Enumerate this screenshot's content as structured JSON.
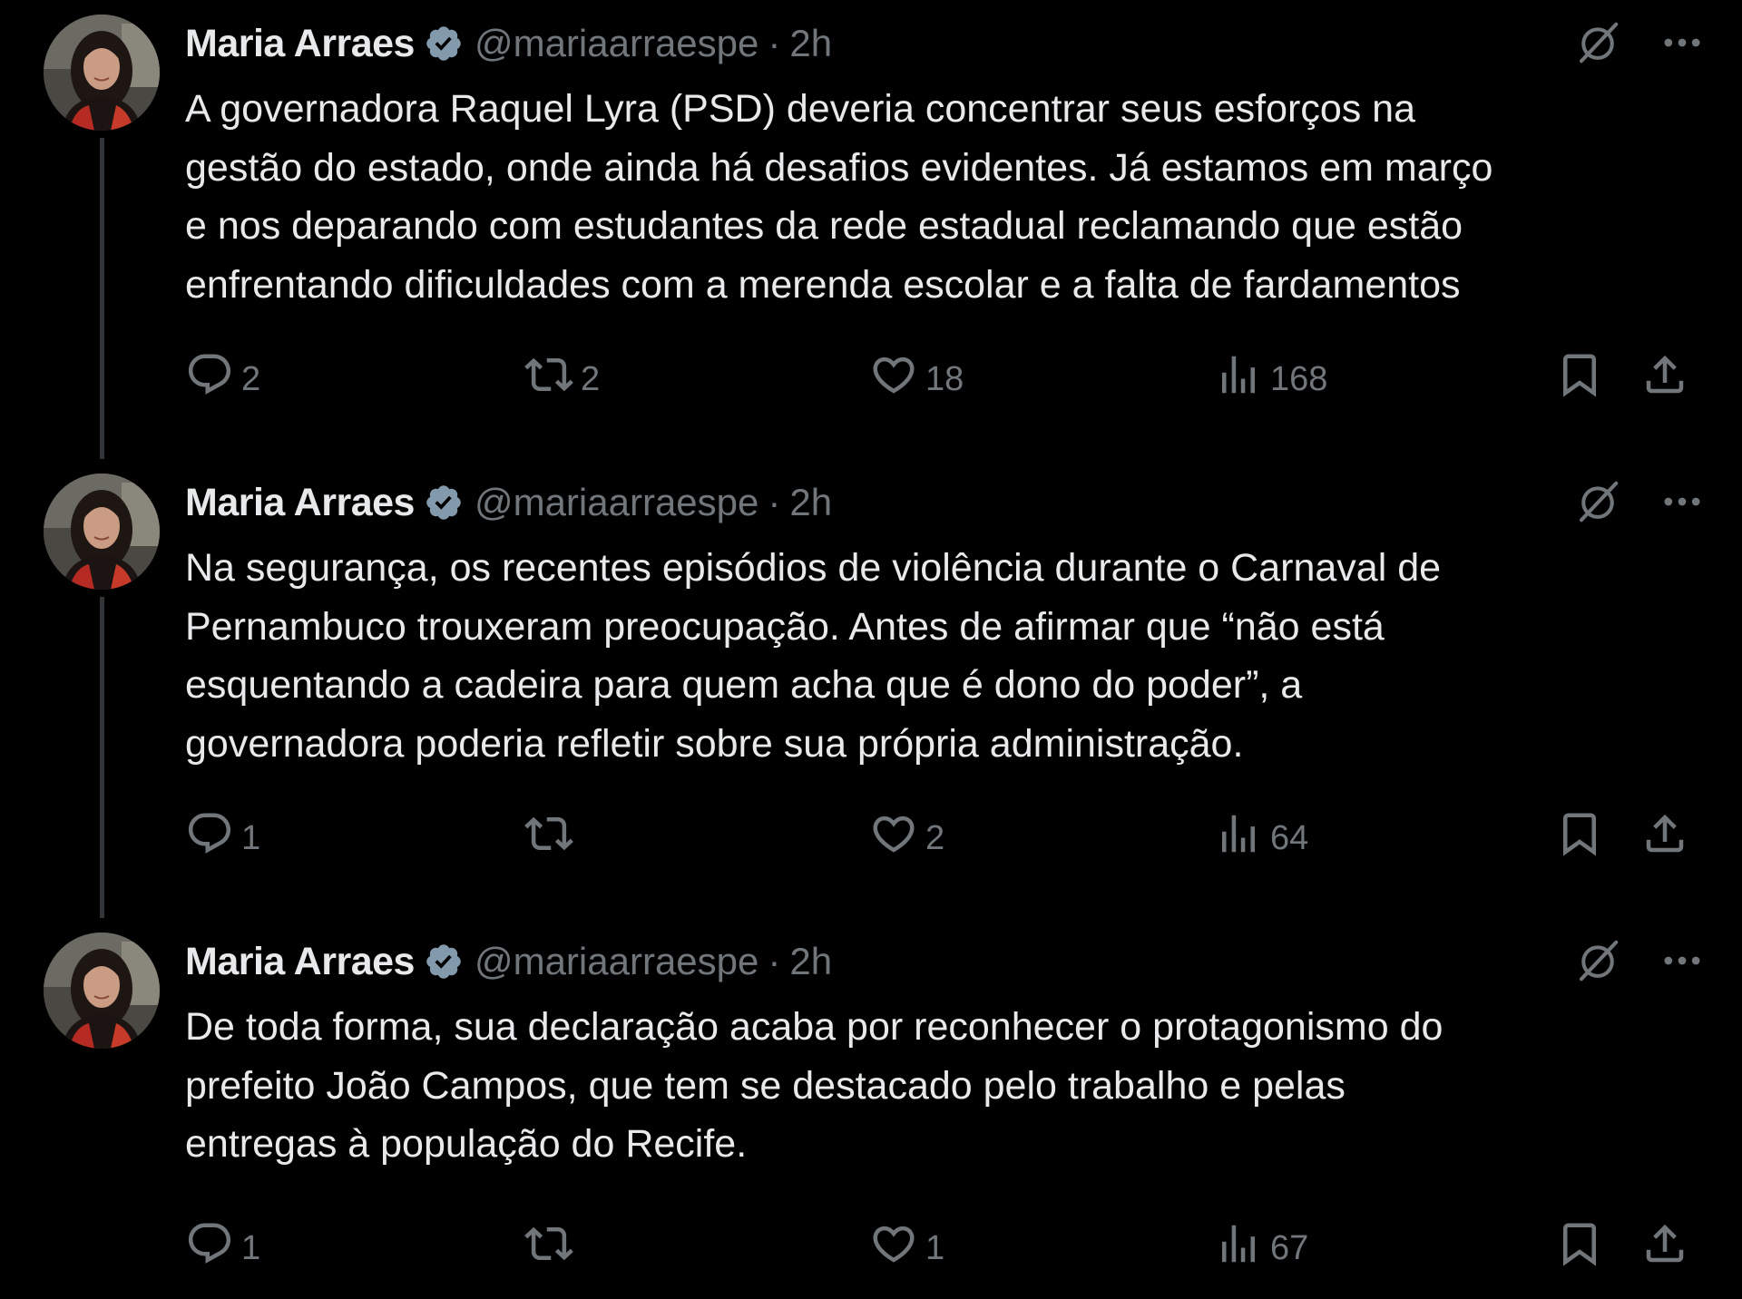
{
  "colors": {
    "background": "#000000",
    "text_primary": "#e7e9ea",
    "text_secondary": "#71767b",
    "verified_badge": "#829aab",
    "thread_line": "#333639"
  },
  "tweets": [
    {
      "author": {
        "name": "Maria Arraes",
        "handle": "@mariaarraespe",
        "verified": true,
        "avatar_icon": "profile-photo"
      },
      "separator": "·",
      "time": "2h",
      "text_lines": [
        "A governadora Raquel Lyra (PSD) deveria concentrar seus esforços na",
        "gestão do estado, onde ainda há desafios evidentes. Já estamos em março",
        "e nos deparando com estudantes da rede estadual reclamando que estão",
        "enfrentando dificuldades com a merenda escolar e a falta de fardamentos"
      ],
      "stats": {
        "replies": "2",
        "retweets": "2",
        "likes": "18",
        "views": "168"
      }
    },
    {
      "author": {
        "name": "Maria Arraes",
        "handle": "@mariaarraespe",
        "verified": true,
        "avatar_icon": "profile-photo"
      },
      "separator": "·",
      "time": "2h",
      "text_lines": [
        "Na segurança, os recentes episódios de violência durante o Carnaval de",
        "Pernambuco trouxeram preocupação. Antes de afirmar que “não está",
        "esquentando a cadeira para quem acha que é dono do poder”, a",
        "governadora poderia refletir sobre sua própria administração."
      ],
      "stats": {
        "replies": "1",
        "retweets": "",
        "likes": "2",
        "views": "64"
      }
    },
    {
      "author": {
        "name": "Maria Arraes",
        "handle": "@mariaarraespe",
        "verified": true,
        "avatar_icon": "profile-photo"
      },
      "separator": "·",
      "time": "2h",
      "text_lines": [
        "De toda forma, sua declaração acaba por reconhecer o protagonismo do",
        "prefeito João Campos, que tem se destacado pelo trabalho e pelas",
        "entregas à população do Recife."
      ],
      "stats": {
        "replies": "1",
        "retweets": "",
        "likes": "1",
        "views": "67"
      }
    }
  ],
  "icons": {
    "header": [
      "grok-icon",
      "more-options-icon"
    ],
    "actions": [
      "reply-icon",
      "retweet-icon",
      "like-icon",
      "views-icon",
      "bookmark-icon",
      "share-icon"
    ]
  }
}
